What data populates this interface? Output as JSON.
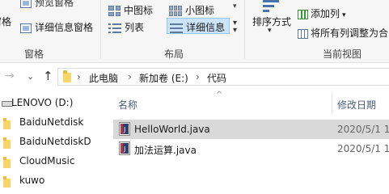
{
  "ribbon": {
    "preview_pane": "预览窗格",
    "panes_partial": "窗格",
    "details_pane": "详细信息窗格",
    "group_panes": "窗格",
    "medium_icons": "中图标",
    "small_icons": "小图标",
    "list": "列表",
    "details": "详细信息",
    "group_layout": "布局",
    "sort_by": "排序方式",
    "add_column": "添加列",
    "fit_columns": "将所有列调整为合",
    "group_current_view": "当前视图"
  },
  "address": {
    "crumbs": [
      "此电脑",
      "新加卷 (E:)",
      "代码"
    ]
  },
  "nav": {
    "items": [
      {
        "label": "LENOVO (D:)",
        "icon": "drive-icon"
      },
      {
        "label": "BaiduNetdisk",
        "icon": "folder-icon"
      },
      {
        "label": "BaiduNetdiskD",
        "icon": "folder-icon"
      },
      {
        "label": "CloudMusic",
        "icon": "folder-icon"
      },
      {
        "label": "kuwo",
        "icon": "folder-icon"
      }
    ]
  },
  "list": {
    "columns": {
      "name": "名称",
      "modified": "修改日期"
    },
    "files": [
      {
        "name": "HelloWorld.java",
        "modified": "2020/5/1 1",
        "selected": true
      },
      {
        "name": "加法运算.java",
        "modified": "2020/5/1 1",
        "selected": false
      }
    ]
  },
  "colors": {
    "selection": "#cce4f7",
    "row_selected": "#d9d9d9",
    "folder": "#f8d567",
    "column_header": "#4c607a"
  }
}
